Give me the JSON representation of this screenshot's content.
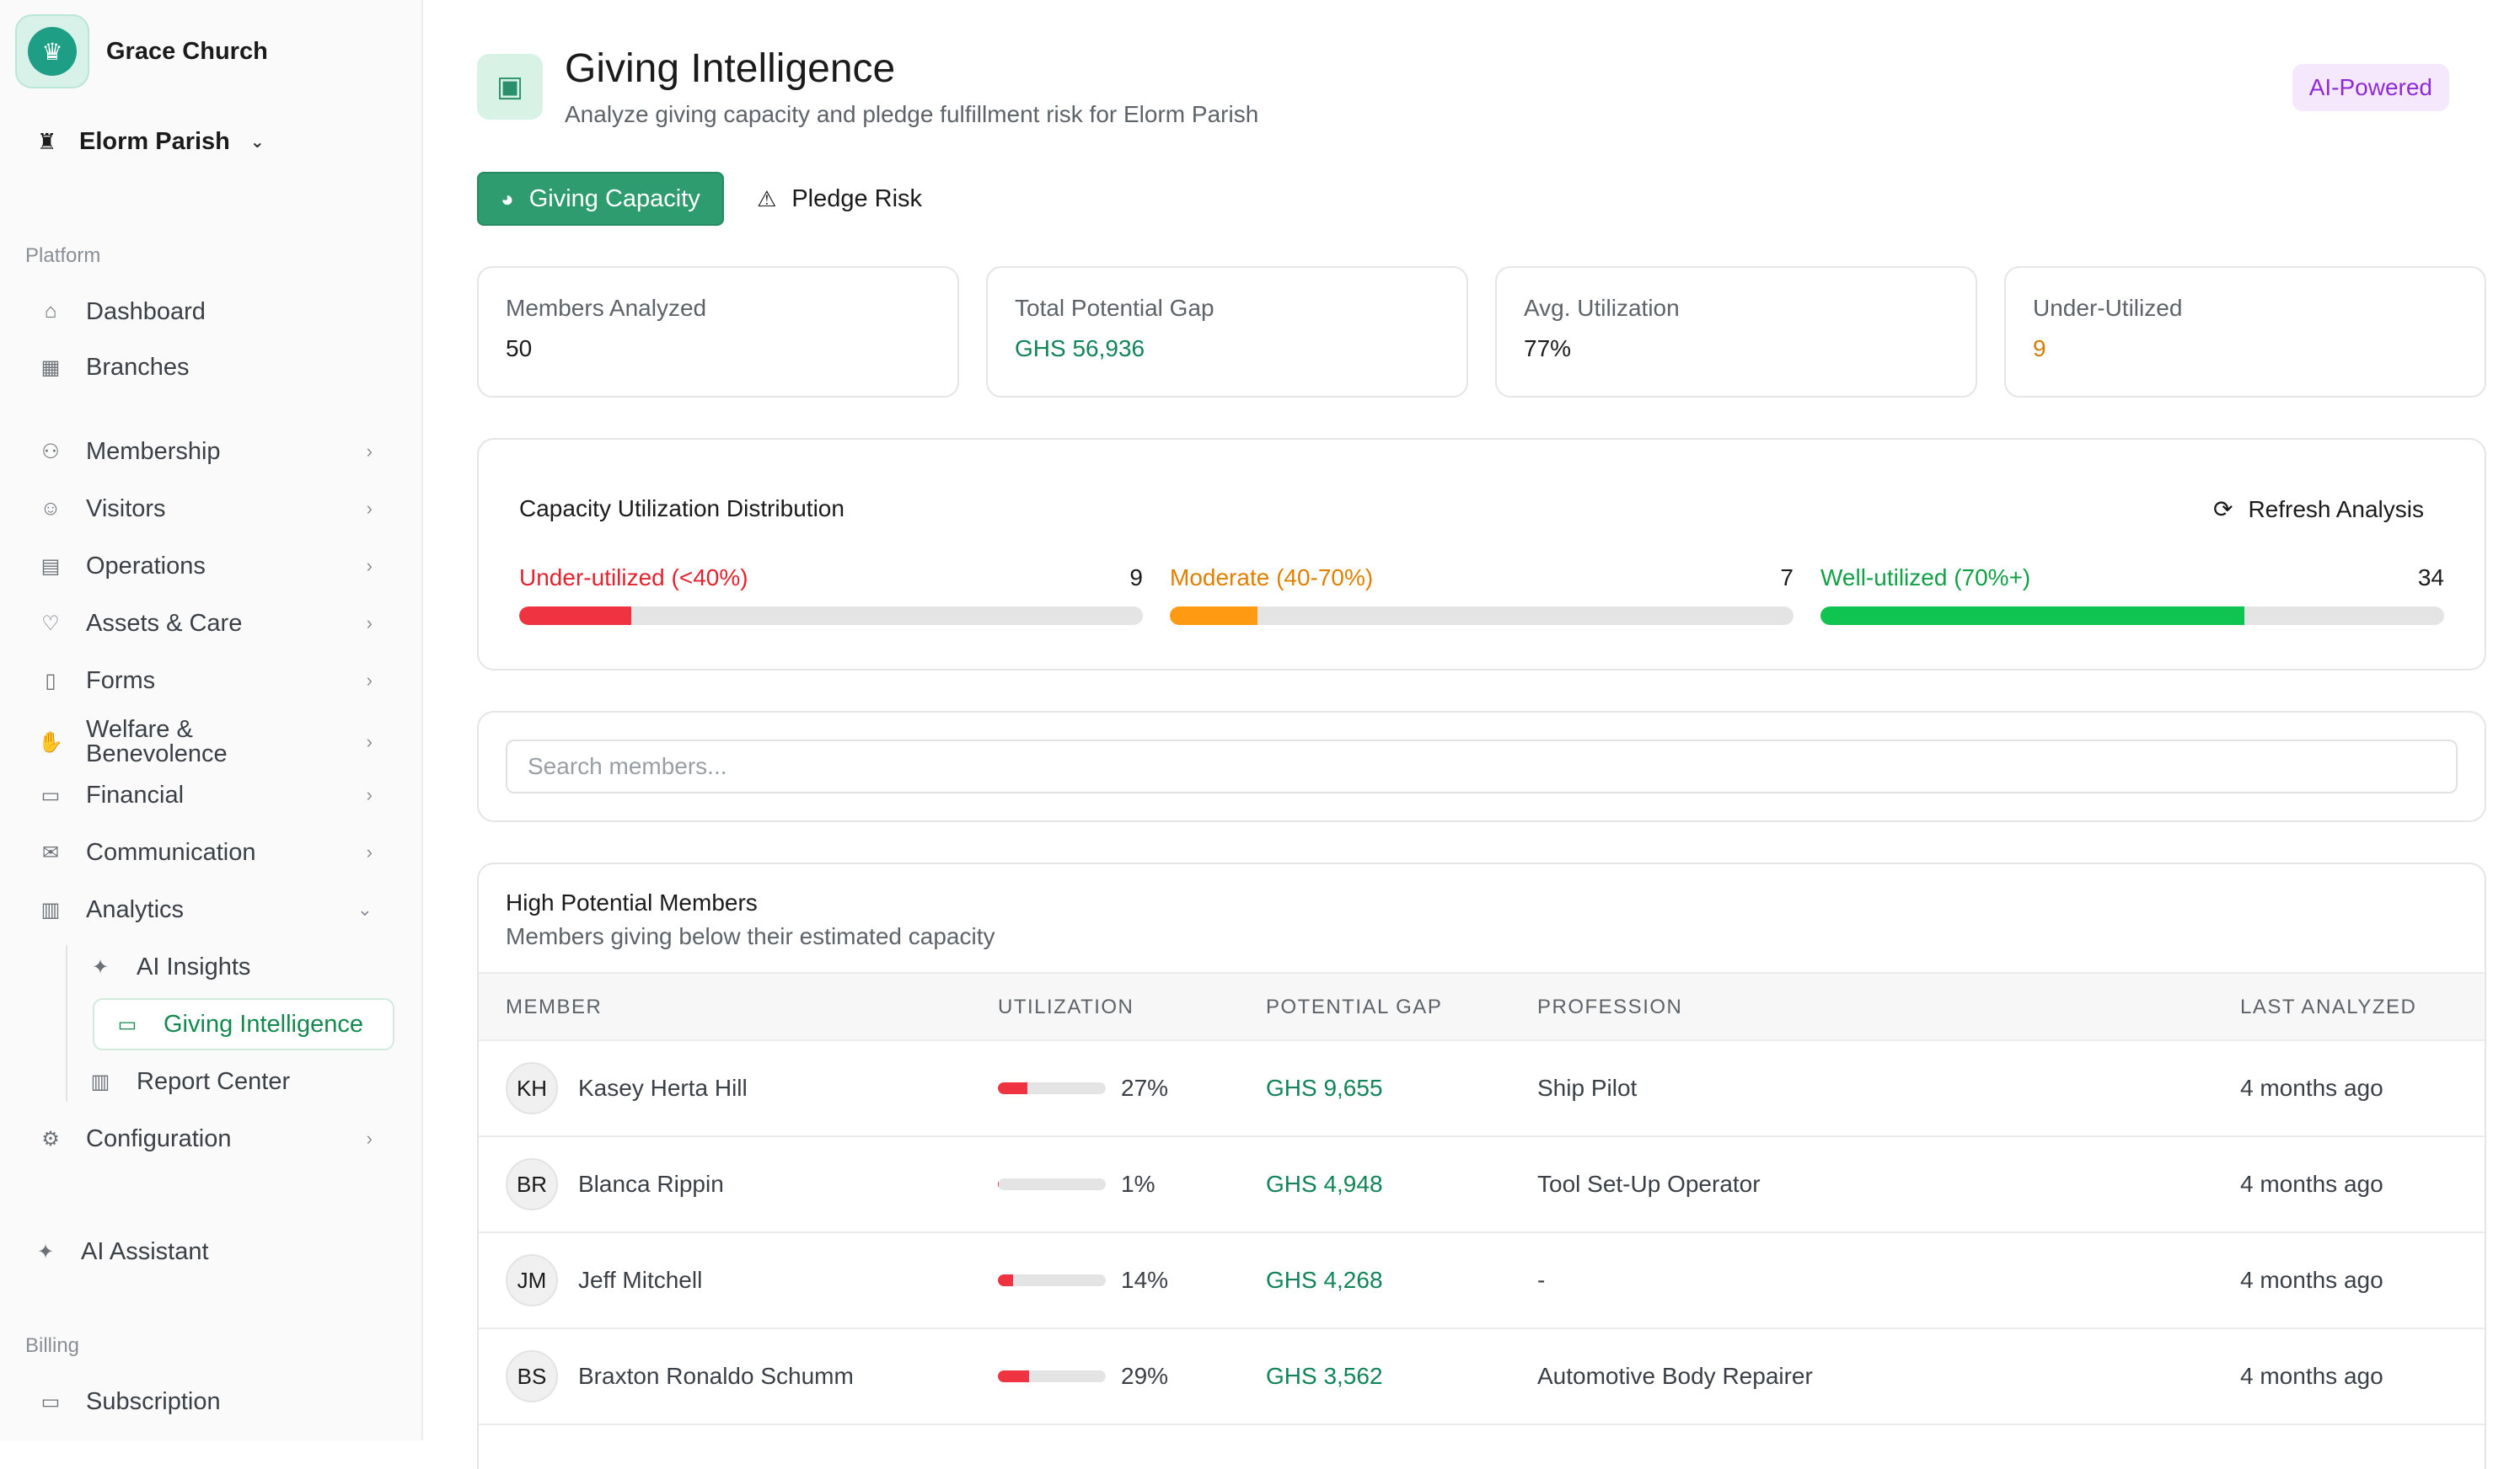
{
  "sidebar": {
    "brand": "Grace Church",
    "parish": "Elorm Parish",
    "platform_label": "Platform",
    "billing_label": "Billing",
    "items": {
      "dashboard": "Dashboard",
      "branches": "Branches",
      "membership": "Membership",
      "visitors": "Visitors",
      "operations": "Operations",
      "assets": "Assets & Care",
      "forms": "Forms",
      "welfare_line1": "Welfare &",
      "welfare_line2": "Benevolence",
      "financial": "Financial",
      "communication": "Communication",
      "analytics": "Analytics",
      "ai_insights": "AI Insights",
      "giving_intelligence": "Giving Intelligence",
      "report_center": "Report Center",
      "configuration": "Configuration",
      "ai_assistant": "AI Assistant",
      "subscription": "Subscription"
    }
  },
  "header": {
    "title": "Giving Intelligence",
    "subtitle": "Analyze giving capacity and pledge fulfillment risk for Elorm Parish",
    "badge": "AI-Powered"
  },
  "tabs": {
    "capacity": "Giving Capacity",
    "pledge": "Pledge Risk"
  },
  "stats": [
    {
      "label": "Members Analyzed",
      "value": "50"
    },
    {
      "label": "Total Potential Gap",
      "value": "GHS 56,936"
    },
    {
      "label": "Avg. Utilization",
      "value": "77%"
    },
    {
      "label": "Under-Utilized",
      "value": "9"
    }
  ],
  "distribution": {
    "title": "Capacity Utilization Distribution",
    "refresh": "Refresh Analysis",
    "buckets": [
      {
        "label": "Under-utilized (<40%)",
        "count": "9",
        "fraction": 0.18,
        "color": "#ef3340"
      },
      {
        "label": "Moderate (40-70%)",
        "count": "7",
        "fraction": 0.14,
        "color": "#ff9a12"
      },
      {
        "label": "Well-utilized (70%+)",
        "count": "34",
        "fraction": 0.68,
        "color": "#10c452"
      }
    ]
  },
  "search": {
    "placeholder": "Search members..."
  },
  "table": {
    "title": "High Potential Members",
    "subtitle": "Members giving below their estimated capacity",
    "columns": [
      "MEMBER",
      "UTILIZATION",
      "POTENTIAL GAP",
      "PROFESSION",
      "LAST ANALYZED"
    ],
    "rows": [
      {
        "initials": "KH",
        "name": "Kasey Herta Hill",
        "utilization": "27%",
        "util_fraction": 0.27,
        "gap": "GHS 9,655",
        "profession": "Ship Pilot",
        "analyzed": "4 months ago"
      },
      {
        "initials": "BR",
        "name": "Blanca Rippin",
        "utilization": "1%",
        "util_fraction": 0.01,
        "gap": "GHS 4,948",
        "profession": "Tool Set-Up Operator",
        "analyzed": "4 months ago"
      },
      {
        "initials": "JM",
        "name": "Jeff Mitchell",
        "utilization": "14%",
        "util_fraction": 0.14,
        "gap": "GHS 4,268",
        "profession": "-",
        "analyzed": "4 months ago"
      },
      {
        "initials": "BS",
        "name": "Braxton Ronaldo Schumm",
        "utilization": "29%",
        "util_fraction": 0.29,
        "gap": "GHS 3,562",
        "profession": "Automotive Body Repairer",
        "analyzed": "4 months ago"
      }
    ]
  }
}
